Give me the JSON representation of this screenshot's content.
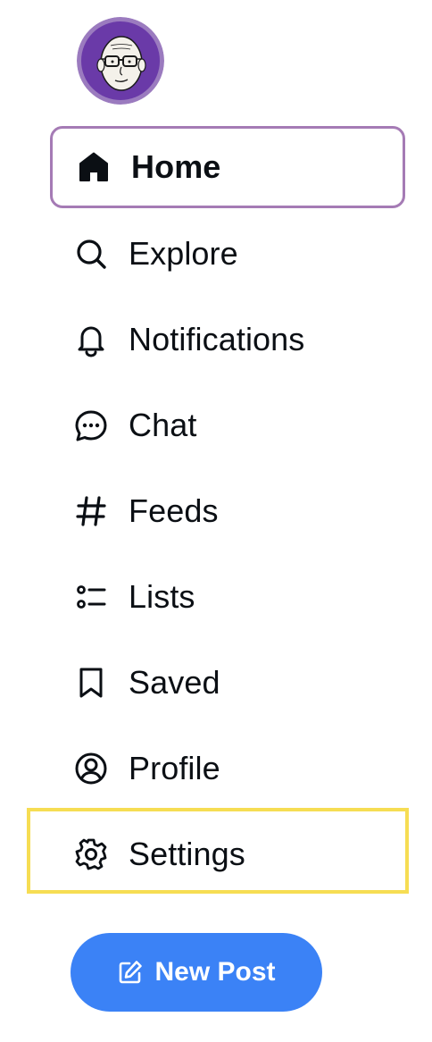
{
  "avatar": {
    "alt": "User avatar",
    "icon": "avatar-illustration"
  },
  "nav": {
    "items": [
      {
        "label": "Home",
        "icon": "home-icon",
        "active": true
      },
      {
        "label": "Explore",
        "icon": "search-icon"
      },
      {
        "label": "Notifications",
        "icon": "bell-icon"
      },
      {
        "label": "Chat",
        "icon": "chat-bubble-icon"
      },
      {
        "label": "Feeds",
        "icon": "hash-icon"
      },
      {
        "label": "Lists",
        "icon": "list-icon"
      },
      {
        "label": "Saved",
        "icon": "bookmark-icon"
      },
      {
        "label": "Profile",
        "icon": "user-circle-icon"
      },
      {
        "label": "Settings",
        "icon": "gear-icon"
      }
    ]
  },
  "new_post": {
    "label": "New Post",
    "icon": "compose-icon"
  },
  "colors": {
    "active_border": "#a57bb5",
    "highlight_box": "#f6dd53",
    "primary_button": "#3b82f6",
    "text": "#0b0f14"
  }
}
